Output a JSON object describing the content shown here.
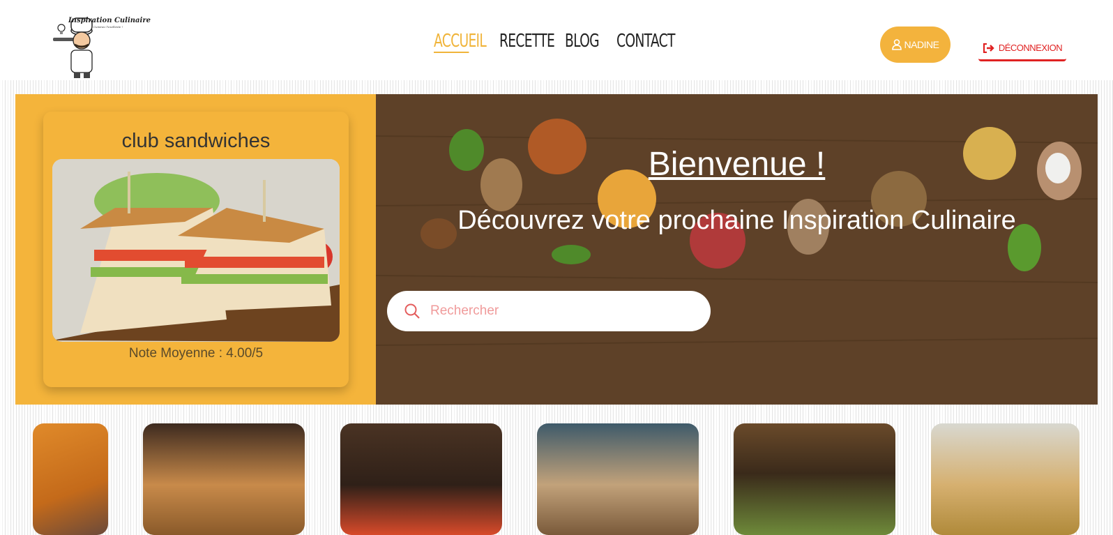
{
  "logo": {
    "title": "Inspiration Culinaire",
    "subtitle": "Cuisinez l'exellente !"
  },
  "nav": {
    "items": [
      {
        "label": "Accueil",
        "active": true
      },
      {
        "label": "Recette",
        "active": false
      },
      {
        "label": "Blog",
        "active": false
      },
      {
        "label": "Contact",
        "active": false
      }
    ]
  },
  "user": {
    "name": "Nadine",
    "icon": "user-icon"
  },
  "logout": {
    "label": "Déconnexion",
    "icon": "sign-out-icon"
  },
  "featured": {
    "title": "club sandwiches",
    "rating": "Note Moyenne : 4.00/5"
  },
  "hero": {
    "welcome": "Bienvenue !",
    "tagline": "Découvrez votre prochaine Inspiration Culinaire"
  },
  "search": {
    "placeholder": "Rechercher",
    "icon": "search-icon"
  },
  "colors": {
    "accent": "#f4b43b",
    "logout": "#e02222",
    "search_text": "#f09b9b"
  }
}
